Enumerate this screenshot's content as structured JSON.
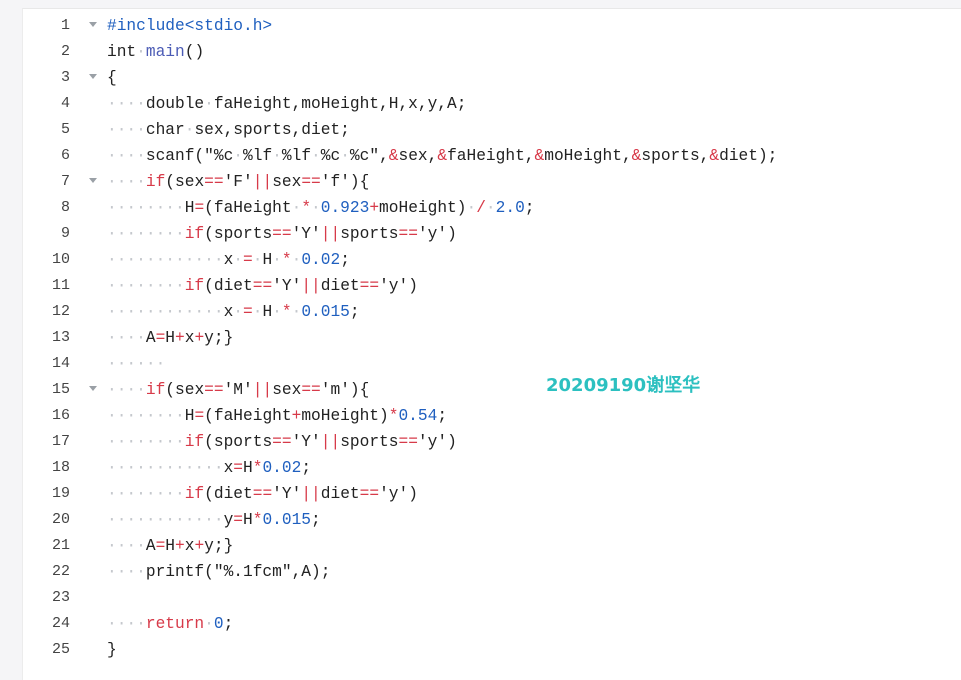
{
  "colors": {
    "keyword": "#d73a49",
    "number": "#1f5fbf",
    "function": "#4b5bb5",
    "watermark": "#2cc0c0",
    "whitespace_marker": "#c4c7cc"
  },
  "watermark": "20209190谢坚华",
  "lines": [
    {
      "n": "1",
      "fold": true,
      "tokens": [
        [
          "pre",
          "#include<stdio.h>"
        ]
      ]
    },
    {
      "n": "2",
      "tokens": [
        [
          "kw2",
          "int"
        ],
        [
          "ws",
          "·"
        ],
        [
          "fn",
          "main"
        ],
        [
          "plain",
          "()"
        ]
      ]
    },
    {
      "n": "3",
      "fold": true,
      "tokens": [
        [
          "plain",
          "{"
        ]
      ]
    },
    {
      "n": "4",
      "tokens": [
        [
          "ws",
          "····"
        ],
        [
          "plain",
          "double"
        ],
        [
          "ws",
          "·"
        ],
        [
          "plain",
          "faHeight,moHeight,H,x,y,A;"
        ]
      ]
    },
    {
      "n": "5",
      "tokens": [
        [
          "ws",
          "····"
        ],
        [
          "plain",
          "char"
        ],
        [
          "ws",
          "·"
        ],
        [
          "plain",
          "sex,sports,diet;"
        ]
      ]
    },
    {
      "n": "6",
      "tokens": [
        [
          "ws",
          "····"
        ],
        [
          "plain",
          "scanf(\"%c"
        ],
        [
          "ws",
          "·"
        ],
        [
          "plain",
          "%lf"
        ],
        [
          "ws",
          "·"
        ],
        [
          "plain",
          "%lf"
        ],
        [
          "ws",
          "·"
        ],
        [
          "plain",
          "%c"
        ],
        [
          "ws",
          "·"
        ],
        [
          "plain",
          "%c\","
        ],
        [
          "op",
          "&"
        ],
        [
          "plain",
          "sex,"
        ],
        [
          "op",
          "&"
        ],
        [
          "plain",
          "faHeight,"
        ],
        [
          "op",
          "&"
        ],
        [
          "plain",
          "moHeight,"
        ],
        [
          "op",
          "&"
        ],
        [
          "plain",
          "sports,"
        ],
        [
          "op",
          "&"
        ],
        [
          "plain",
          "diet);"
        ]
      ]
    },
    {
      "n": "7",
      "fold": true,
      "tokens": [
        [
          "ws",
          "····"
        ],
        [
          "kw",
          "if"
        ],
        [
          "plain",
          "(sex"
        ],
        [
          "op",
          "=="
        ],
        [
          "plain",
          "'F'"
        ],
        [
          "op",
          "||"
        ],
        [
          "plain",
          "sex"
        ],
        [
          "op",
          "=="
        ],
        [
          "plain",
          "'f'){"
        ]
      ]
    },
    {
      "n": "8",
      "tokens": [
        [
          "ws",
          "········"
        ],
        [
          "plain",
          "H"
        ],
        [
          "op",
          "="
        ],
        [
          "plain",
          "(faHeight"
        ],
        [
          "ws",
          "·"
        ],
        [
          "op",
          "*"
        ],
        [
          "ws",
          "·"
        ],
        [
          "num",
          "0.923"
        ],
        [
          "op",
          "+"
        ],
        [
          "plain",
          "moHeight)"
        ],
        [
          "ws",
          "·"
        ],
        [
          "op",
          "/"
        ],
        [
          "ws",
          "·"
        ],
        [
          "num",
          "2.0"
        ],
        [
          "plain",
          ";"
        ]
      ]
    },
    {
      "n": "9",
      "tokens": [
        [
          "ws",
          "········"
        ],
        [
          "kw",
          "if"
        ],
        [
          "plain",
          "(sports"
        ],
        [
          "op",
          "=="
        ],
        [
          "plain",
          "'Y'"
        ],
        [
          "op",
          "||"
        ],
        [
          "plain",
          "sports"
        ],
        [
          "op",
          "=="
        ],
        [
          "plain",
          "'y')"
        ]
      ]
    },
    {
      "n": "10",
      "tokens": [
        [
          "ws",
          "············"
        ],
        [
          "plain",
          "x"
        ],
        [
          "ws",
          "·"
        ],
        [
          "op",
          "="
        ],
        [
          "ws",
          "·"
        ],
        [
          "plain",
          "H"
        ],
        [
          "ws",
          "·"
        ],
        [
          "op",
          "*"
        ],
        [
          "ws",
          "·"
        ],
        [
          "num",
          "0.02"
        ],
        [
          "plain",
          ";"
        ]
      ]
    },
    {
      "n": "11",
      "tokens": [
        [
          "ws",
          "········"
        ],
        [
          "kw",
          "if"
        ],
        [
          "plain",
          "(diet"
        ],
        [
          "op",
          "=="
        ],
        [
          "plain",
          "'Y'"
        ],
        [
          "op",
          "||"
        ],
        [
          "plain",
          "diet"
        ],
        [
          "op",
          "=="
        ],
        [
          "plain",
          "'y')"
        ]
      ]
    },
    {
      "n": "12",
      "tokens": [
        [
          "ws",
          "············"
        ],
        [
          "plain",
          "x"
        ],
        [
          "ws",
          "·"
        ],
        [
          "op",
          "="
        ],
        [
          "ws",
          "·"
        ],
        [
          "plain",
          "H"
        ],
        [
          "ws",
          "·"
        ],
        [
          "op",
          "*"
        ],
        [
          "ws",
          "·"
        ],
        [
          "num",
          "0.015"
        ],
        [
          "plain",
          ";"
        ]
      ]
    },
    {
      "n": "13",
      "tokens": [
        [
          "ws",
          "····"
        ],
        [
          "plain",
          "A"
        ],
        [
          "op",
          "="
        ],
        [
          "plain",
          "H"
        ],
        [
          "op",
          "+"
        ],
        [
          "plain",
          "x"
        ],
        [
          "op",
          "+"
        ],
        [
          "plain",
          "y;}"
        ]
      ]
    },
    {
      "n": "14",
      "tokens": [
        [
          "ws",
          "······"
        ]
      ]
    },
    {
      "n": "15",
      "fold": true,
      "tokens": [
        [
          "ws",
          "····"
        ],
        [
          "kw",
          "if"
        ],
        [
          "plain",
          "(sex"
        ],
        [
          "op",
          "=="
        ],
        [
          "plain",
          "'M'"
        ],
        [
          "op",
          "||"
        ],
        [
          "plain",
          "sex"
        ],
        [
          "op",
          "=="
        ],
        [
          "plain",
          "'m'){"
        ]
      ]
    },
    {
      "n": "16",
      "tokens": [
        [
          "ws",
          "········"
        ],
        [
          "plain",
          "H"
        ],
        [
          "op",
          "="
        ],
        [
          "plain",
          "(faHeight"
        ],
        [
          "op",
          "+"
        ],
        [
          "plain",
          "moHeight)"
        ],
        [
          "op",
          "*"
        ],
        [
          "num",
          "0.54"
        ],
        [
          "plain",
          ";"
        ]
      ]
    },
    {
      "n": "17",
      "tokens": [
        [
          "ws",
          "········"
        ],
        [
          "kw",
          "if"
        ],
        [
          "plain",
          "(sports"
        ],
        [
          "op",
          "=="
        ],
        [
          "plain",
          "'Y'"
        ],
        [
          "op",
          "||"
        ],
        [
          "plain",
          "sports"
        ],
        [
          "op",
          "=="
        ],
        [
          "plain",
          "'y')"
        ]
      ]
    },
    {
      "n": "18",
      "tokens": [
        [
          "ws",
          "············"
        ],
        [
          "plain",
          "x"
        ],
        [
          "op",
          "="
        ],
        [
          "plain",
          "H"
        ],
        [
          "op",
          "*"
        ],
        [
          "num",
          "0.02"
        ],
        [
          "plain",
          ";"
        ]
      ]
    },
    {
      "n": "19",
      "tokens": [
        [
          "ws",
          "········"
        ],
        [
          "kw",
          "if"
        ],
        [
          "plain",
          "(diet"
        ],
        [
          "op",
          "=="
        ],
        [
          "plain",
          "'Y'"
        ],
        [
          "op",
          "||"
        ],
        [
          "plain",
          "diet"
        ],
        [
          "op",
          "=="
        ],
        [
          "plain",
          "'y')"
        ]
      ]
    },
    {
      "n": "20",
      "tokens": [
        [
          "ws",
          "············"
        ],
        [
          "plain",
          "y"
        ],
        [
          "op",
          "="
        ],
        [
          "plain",
          "H"
        ],
        [
          "op",
          "*"
        ],
        [
          "num",
          "0.015"
        ],
        [
          "plain",
          ";"
        ]
      ]
    },
    {
      "n": "21",
      "tokens": [
        [
          "ws",
          "····"
        ],
        [
          "plain",
          "A"
        ],
        [
          "op",
          "="
        ],
        [
          "plain",
          "H"
        ],
        [
          "op",
          "+"
        ],
        [
          "plain",
          "x"
        ],
        [
          "op",
          "+"
        ],
        [
          "plain",
          "y;}"
        ]
      ]
    },
    {
      "n": "22",
      "tokens": [
        [
          "ws",
          "····"
        ],
        [
          "plain",
          "printf(\"%.1fcm\",A);"
        ]
      ]
    },
    {
      "n": "23",
      "tokens": []
    },
    {
      "n": "24",
      "tokens": [
        [
          "ws",
          "····"
        ],
        [
          "kw",
          "return"
        ],
        [
          "ws",
          "·"
        ],
        [
          "num",
          "0"
        ],
        [
          "plain",
          ";"
        ]
      ]
    },
    {
      "n": "25",
      "tokens": [
        [
          "plain",
          "}"
        ]
      ]
    }
  ]
}
